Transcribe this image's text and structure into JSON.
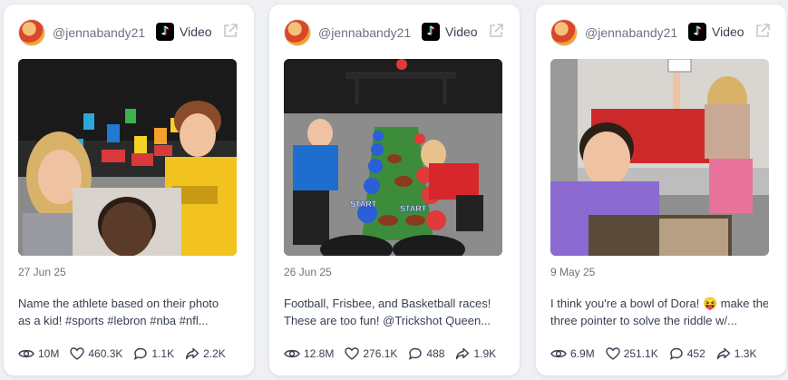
{
  "cards": [
    {
      "handle": "@jennabandy21",
      "type_label": "Video",
      "date": "27 Jun 25",
      "caption_line1": "Name the athlete based on their photo",
      "caption_line2": "as a kid! #sports #lebron #nba #nfl...",
      "views": "10M",
      "likes": "460.3K",
      "comments": "1.1K",
      "shares": "2.2K"
    },
    {
      "handle": "@jennabandy21",
      "type_label": "Video",
      "date": "26 Jun 25",
      "caption_line1": "Football, Frisbee, and Basketball races!",
      "caption_line2": "These are too fun! @Trickshot Queen...",
      "views": "12.8M",
      "likes": "276.1K",
      "comments": "488",
      "shares": "1.9K",
      "thumb_labels": [
        "START",
        "START"
      ]
    },
    {
      "handle": "@jennabandy21",
      "type_label": "Video",
      "date": "9 May 25",
      "caption_line1": "I think you're a bowl of Dora! 😝 make the",
      "caption_line2": "three pointer to solve the riddle w/...",
      "views": "6.9M",
      "likes": "251.1K",
      "comments": "452",
      "shares": "1.3K"
    }
  ],
  "icons": {
    "platform": "tiktok-icon",
    "external": "external-link-icon",
    "views": "eye-icon",
    "likes": "heart-icon",
    "comments": "comment-icon",
    "shares": "share-icon"
  },
  "colors": {
    "background": "#eef0f4",
    "card": "#ffffff",
    "muted_text": "#6b7280",
    "body_text": "#374151"
  }
}
